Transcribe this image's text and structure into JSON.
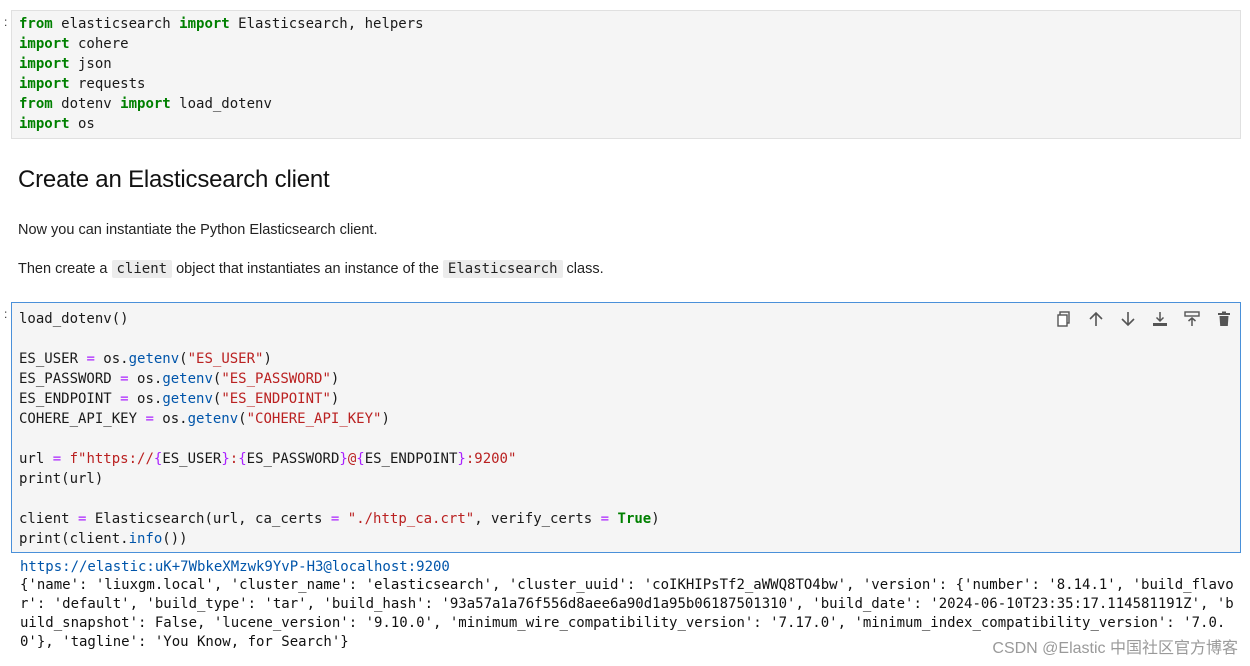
{
  "cell1": {
    "lines": [
      [
        {
          "t": "from",
          "c": "kw"
        },
        {
          "t": " elasticsearch "
        },
        {
          "t": "import",
          "c": "kw"
        },
        {
          "t": " Elasticsearch, helpers"
        }
      ],
      [
        {
          "t": "import",
          "c": "kw"
        },
        {
          "t": " cohere"
        }
      ],
      [
        {
          "t": "import",
          "c": "kw"
        },
        {
          "t": " json"
        }
      ],
      [
        {
          "t": "import",
          "c": "kw"
        },
        {
          "t": " requests"
        }
      ],
      [
        {
          "t": "from",
          "c": "kw"
        },
        {
          "t": " dotenv "
        },
        {
          "t": "import",
          "c": "kw"
        },
        {
          "t": " load_dotenv"
        }
      ],
      [
        {
          "t": "import",
          "c": "kw"
        },
        {
          "t": " os"
        }
      ]
    ]
  },
  "markdown": {
    "heading": "Create an Elasticsearch client",
    "para1": "Now you can instantiate the Python Elasticsearch client.",
    "para2_before": "Then create a ",
    "para2_code1": "client",
    "para2_middle": " object that instantiates an instance of the ",
    "para2_code2": "Elasticsearch",
    "para2_after": " class."
  },
  "cell2": {
    "lines": [
      [
        {
          "t": "load_dotenv()"
        }
      ],
      [],
      [
        {
          "t": "ES_USER "
        },
        {
          "t": "=",
          "c": "op"
        },
        {
          "t": " os."
        },
        {
          "t": "getenv",
          "c": "fn"
        },
        {
          "t": "("
        },
        {
          "t": "\"ES_USER\"",
          "c": "str"
        },
        {
          "t": ")"
        }
      ],
      [
        {
          "t": "ES_PASSWORD "
        },
        {
          "t": "=",
          "c": "op"
        },
        {
          "t": " os."
        },
        {
          "t": "getenv",
          "c": "fn"
        },
        {
          "t": "("
        },
        {
          "t": "\"ES_PASSWORD\"",
          "c": "str"
        },
        {
          "t": ")"
        }
      ],
      [
        {
          "t": "ES_ENDPOINT "
        },
        {
          "t": "=",
          "c": "op"
        },
        {
          "t": " os."
        },
        {
          "t": "getenv",
          "c": "fn"
        },
        {
          "t": "("
        },
        {
          "t": "\"ES_ENDPOINT\"",
          "c": "str"
        },
        {
          "t": ")"
        }
      ],
      [
        {
          "t": "COHERE_API_KEY "
        },
        {
          "t": "=",
          "c": "op"
        },
        {
          "t": " os."
        },
        {
          "t": "getenv",
          "c": "fn"
        },
        {
          "t": "("
        },
        {
          "t": "\"COHERE_API_KEY\"",
          "c": "str"
        },
        {
          "t": ")"
        }
      ],
      [],
      [
        {
          "t": "url "
        },
        {
          "t": "=",
          "c": "op"
        },
        {
          "t": " "
        },
        {
          "t": "f\"https://",
          "c": "str"
        },
        {
          "t": "{",
          "c": "op"
        },
        {
          "t": "ES_USER"
        },
        {
          "t": "}",
          "c": "op"
        },
        {
          "t": ":",
          "c": "str"
        },
        {
          "t": "{",
          "c": "op"
        },
        {
          "t": "ES_PASSWORD"
        },
        {
          "t": "}",
          "c": "op"
        },
        {
          "t": "@",
          "c": "str"
        },
        {
          "t": "{",
          "c": "op"
        },
        {
          "t": "ES_ENDPOINT"
        },
        {
          "t": "}",
          "c": "op"
        },
        {
          "t": ":9200\"",
          "c": "str"
        }
      ],
      [
        {
          "t": "print(url)"
        }
      ],
      [],
      [
        {
          "t": "client "
        },
        {
          "t": "=",
          "c": "op"
        },
        {
          "t": " Elasticsearch(url, ca_certs "
        },
        {
          "t": "=",
          "c": "op"
        },
        {
          "t": " "
        },
        {
          "t": "\"./http_ca.crt\"",
          "c": "str"
        },
        {
          "t": ", verify_certs "
        },
        {
          "t": "=",
          "c": "op"
        },
        {
          "t": " "
        },
        {
          "t": "True",
          "c": "kw"
        },
        {
          "t": ")"
        }
      ],
      [
        {
          "t": "print(client."
        },
        {
          "t": "info",
          "c": "fn"
        },
        {
          "t": "())"
        }
      ]
    ]
  },
  "toolbar": {
    "buttons": [
      "copy-icon",
      "move-up-icon",
      "move-down-icon",
      "insert-below-icon",
      "insert-above-icon",
      "delete-icon"
    ]
  },
  "output": {
    "url": "https://elastic:uK+7WbkeXMzwk9YvP-H3@localhost:9200",
    "info": "{'name': 'liuxgm.local', 'cluster_name': 'elasticsearch', 'cluster_uuid': 'coIKHIPsTf2_aWWQ8TO4bw', 'version': {'number': '8.14.1', 'build_flavor': 'default', 'build_type': 'tar', 'build_hash': '93a57a1a76f556d8aee6a90d1a95b06187501310', 'build_date': '2024-06-10T23:35:17.114581191Z', 'build_snapshot': False, 'lucene_version': '9.10.0', 'minimum_wire_compatibility_version': '7.17.0', 'minimum_index_compatibility_version': '7.0.0'}, 'tagline': 'You Know, for Search'}"
  },
  "watermark": "CSDN @Elastic 中国社区官方博客",
  "colors": {
    "keyword": "#008000",
    "string": "#ba2121",
    "function": "#0055aa",
    "operator": "#aa22ff",
    "active_border": "#4a90d9"
  }
}
